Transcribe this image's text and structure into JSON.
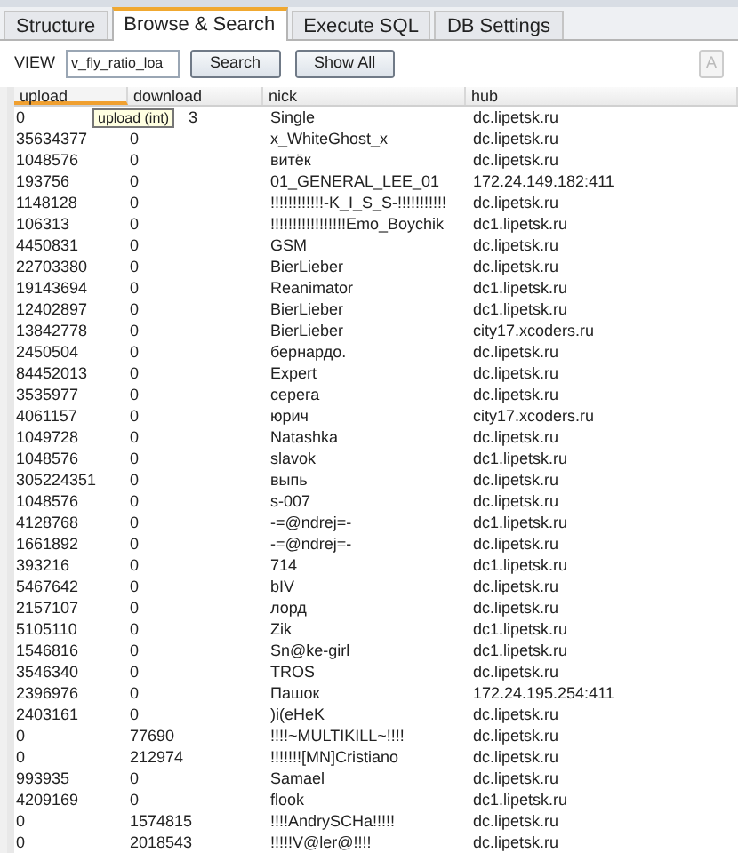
{
  "tabs": [
    {
      "label": "Structure",
      "selected": false
    },
    {
      "label": "Browse & Search",
      "selected": true
    },
    {
      "label": "Execute SQL",
      "selected": false
    },
    {
      "label": "DB Settings",
      "selected": false
    }
  ],
  "toolbar": {
    "view_label": "VIEW",
    "view_value": "v_fly_ratio_loa",
    "buttons": [
      {
        "label": "Search",
        "disabled": false
      },
      {
        "label": "Show All",
        "disabled": false
      },
      {
        "label": "A",
        "disabled": true
      }
    ]
  },
  "table": {
    "columns": [
      {
        "label": "upload",
        "sorted": true
      },
      {
        "label": "download",
        "sorted": false
      },
      {
        "label": "nick",
        "sorted": false
      },
      {
        "label": "hub",
        "sorted": false
      }
    ],
    "tooltip": "upload (int)",
    "rows": [
      [
        "0",
        "3",
        "Single",
        "dc.lipetsk.ru"
      ],
      [
        "35634377",
        "0",
        "x_WhiteGhost_x",
        "dc.lipetsk.ru"
      ],
      [
        "1048576",
        "0",
        "витёк",
        "dc.lipetsk.ru"
      ],
      [
        "193756",
        "0",
        "01_GENERAL_LEE_01",
        "172.24.149.182:411"
      ],
      [
        "1148128",
        "0",
        "!!!!!!!!!!!!-K_I_S_S-!!!!!!!!!!!",
        "dc.lipetsk.ru"
      ],
      [
        "106313",
        "0",
        "!!!!!!!!!!!!!!!!!Emo_Boychik",
        "dc1.lipetsk.ru"
      ],
      [
        "4450831",
        "0",
        "GSM",
        "dc.lipetsk.ru"
      ],
      [
        "22703380",
        "0",
        "BierLieber",
        "dc.lipetsk.ru"
      ],
      [
        "19143694",
        "0",
        "Reanimator",
        "dc1.lipetsk.ru"
      ],
      [
        "12402897",
        "0",
        "BierLieber",
        "dc1.lipetsk.ru"
      ],
      [
        "13842778",
        "0",
        "BierLieber",
        "city17.xcoders.ru"
      ],
      [
        "2450504",
        "0",
        "бернардо.",
        "dc.lipetsk.ru"
      ],
      [
        "84452013",
        "0",
        "Expert",
        "dc.lipetsk.ru"
      ],
      [
        "3535977",
        "0",
        "серега",
        "dc.lipetsk.ru"
      ],
      [
        "4061157",
        "0",
        "юрич",
        "city17.xcoders.ru"
      ],
      [
        "1049728",
        "0",
        "Natashka",
        "dc.lipetsk.ru"
      ],
      [
        "1048576",
        "0",
        "slavok",
        "dc1.lipetsk.ru"
      ],
      [
        "305224351",
        "0",
        "выпь",
        "dc.lipetsk.ru"
      ],
      [
        "1048576",
        "0",
        "s-007",
        "dc.lipetsk.ru"
      ],
      [
        "4128768",
        "0",
        "-=@ndrej=-",
        "dc1.lipetsk.ru"
      ],
      [
        "1661892",
        "0",
        "-=@ndrej=-",
        "dc.lipetsk.ru"
      ],
      [
        "393216",
        "0",
        "714",
        "dc1.lipetsk.ru"
      ],
      [
        "5467642",
        "0",
        "bIV",
        "dc.lipetsk.ru"
      ],
      [
        "2157107",
        "0",
        "лорд",
        "dc.lipetsk.ru"
      ],
      [
        "5105110",
        "0",
        "Zik",
        "dc1.lipetsk.ru"
      ],
      [
        "1546816",
        "0",
        "Sn@ke-girl",
        "dc1.lipetsk.ru"
      ],
      [
        "3546340",
        "0",
        "TROS",
        "dc.lipetsk.ru"
      ],
      [
        "2396976",
        "0",
        "Пашок",
        "172.24.195.254:411"
      ],
      [
        "2403161",
        "0",
        ")i(eHeK",
        "dc.lipetsk.ru"
      ],
      [
        "0",
        "77690",
        "!!!!~MULTIKILL~!!!!",
        "dc.lipetsk.ru"
      ],
      [
        "0",
        "212974",
        "!!!!!!![MN]Cristiano",
        "dc.lipetsk.ru"
      ],
      [
        "993935",
        "0",
        "Samael",
        "dc.lipetsk.ru"
      ],
      [
        "4209169",
        "0",
        "flook",
        "dc1.lipetsk.ru"
      ],
      [
        "0",
        "1574815",
        "!!!!AndrySCHa!!!!!",
        "dc.lipetsk.ru"
      ],
      [
        "0",
        "2018543",
        "!!!!!V@ler@!!!!",
        "dc.lipetsk.ru"
      ]
    ]
  }
}
